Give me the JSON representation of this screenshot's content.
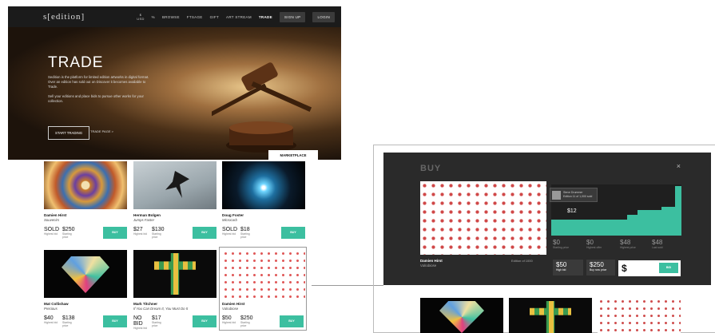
{
  "nav": {
    "logo": "s[edition]",
    "currency_top": "$",
    "currency_bottom": "USD",
    "percent": "%",
    "links": [
      "BROWSE",
      "FTSAGE",
      "GIFT",
      "ART STREAM",
      "TRADE"
    ],
    "signup": "SIGN UP",
    "login": "LOGIN"
  },
  "hero": {
    "title": "TRADE",
    "para1": "Sedition is the platform for limited edition artworks in digital format. Over an edition has sold out on Discover it becomes available to Trade.",
    "para2": "Sell your editions and place bids to pursue other works for your collection.",
    "start_button": "START TRADING",
    "or_link": "TRADE PAGE >",
    "marketplace_tab": "MARKETPLACE"
  },
  "cards": [
    {
      "artist": "Damien Hirst",
      "title": "Souvenirs",
      "low": "SOLD",
      "lowlabel": "Highest bid",
      "mid": "$250",
      "midlabel": "Starting price",
      "buy": "BUY"
    },
    {
      "artist": "Herman Bolgen",
      "title": "Jumps Faster",
      "low": "$27",
      "lowlabel": "Highest bid",
      "mid": "$130",
      "midlabel": "Starting price",
      "buy": "BUY"
    },
    {
      "artist": "Doug Foster",
      "title": "Microcarb",
      "low": "SOLD",
      "lowlabel": "Highest bid",
      "mid": "$18",
      "midlabel": "Starting price",
      "buy": "BUY"
    },
    {
      "artist": "Mat Collishaw",
      "title": "Precious",
      "low": "$40",
      "lowlabel": "Highest bid",
      "mid": "$138",
      "midlabel": "Starting price",
      "buy": "BUY"
    },
    {
      "artist": "Mark Titchner",
      "title": "If You Can Dream It, You Must Do It",
      "low": "NO BID",
      "lowlabel": "Highest bid",
      "mid": "$17",
      "midlabel": "Starting price",
      "buy": "BUY"
    },
    {
      "artist": "Damien Hirst",
      "title": "Valrubiose",
      "low": "$50",
      "lowlabel": "Highest bid",
      "mid": "$250",
      "midlabel": "Starting price",
      "buy": "BUY"
    }
  ],
  "modal": {
    "title": "BUY",
    "close": "×",
    "tip_name": "Steve Drummer",
    "tip_sub": "Edition 11 of 1,000 sold",
    "current_price": "$12",
    "stats": [
      {
        "value": "$0",
        "label": "Starting price"
      },
      {
        "value": "$0",
        "label": "Highest offer"
      },
      {
        "value": "$48",
        "label": "Highest price"
      },
      {
        "value": "$48",
        "label": "Last sold"
      }
    ],
    "artist": "Damien Hirst",
    "work": "Valrubiose",
    "edition": "Edition of 1000",
    "box1": {
      "value": "$50",
      "label": "High bid"
    },
    "box2": {
      "value": "$250",
      "label": "Buy now price"
    },
    "bid_currency": "$",
    "bid_button": "BID"
  },
  "colors": {
    "accent": "#3cbfa0",
    "nav": "#1b1b1b",
    "modal": "#2a2a2a"
  }
}
